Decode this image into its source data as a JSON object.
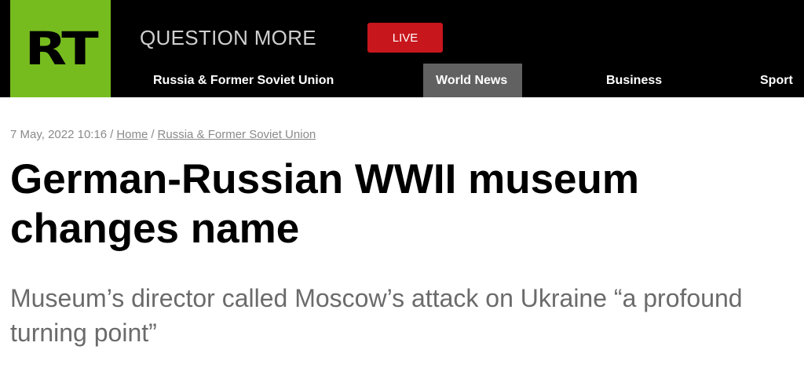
{
  "header": {
    "logo": "RT",
    "tagline": "QUESTION MORE",
    "live_label": "LIVE",
    "nav": [
      {
        "label": "Russia & Former Soviet Union"
      },
      {
        "label": "World News"
      },
      {
        "label": "Business"
      },
      {
        "label": "Sport"
      }
    ],
    "active_nav": "World News"
  },
  "article": {
    "timestamp": "7 May, 2022 10:16",
    "breadcrumb_separator": "/",
    "breadcrumbs": [
      {
        "label": "Home"
      },
      {
        "label": "Russia & Former Soviet Union"
      }
    ],
    "headline": "German-Russian WWII museum changes name",
    "summary": "Museum’s director called Moscow’s attack on Ukraine “a profound turning point”"
  },
  "colors": {
    "brand_green": "#77bc1f",
    "live_red": "#c8161d",
    "header_bg": "#000000",
    "active_nav_bg": "#616161"
  }
}
